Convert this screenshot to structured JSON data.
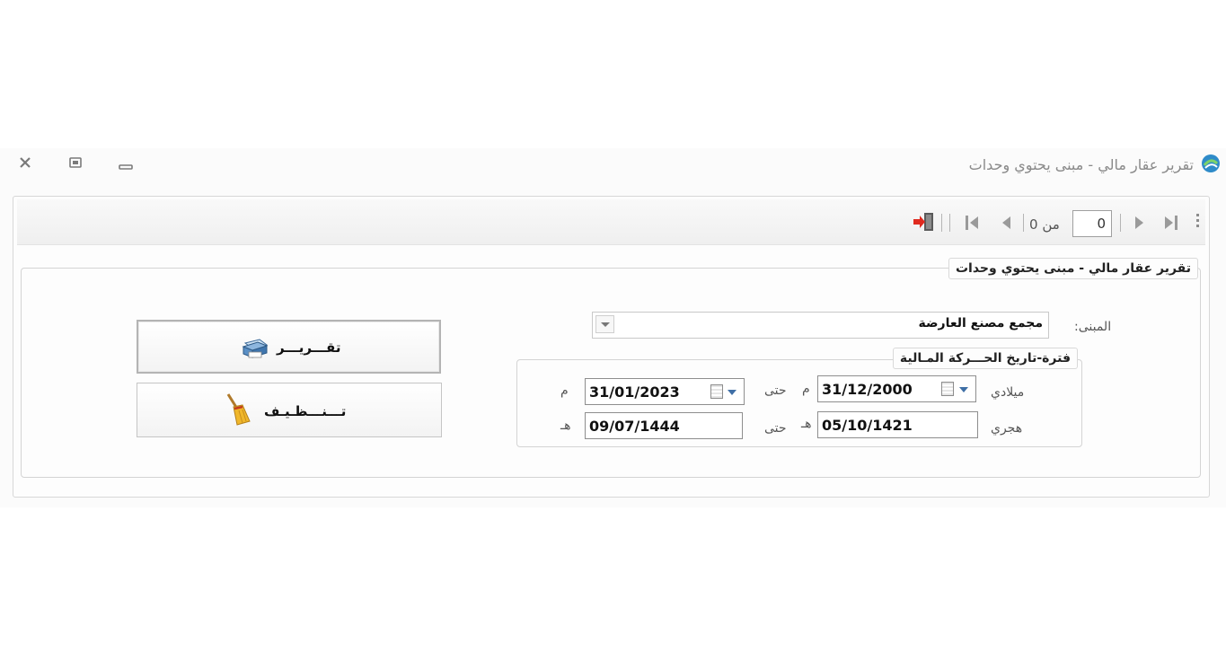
{
  "window": {
    "title": "تقرير عقار مالي - مبنى يحتوي وحدات",
    "controls": {
      "close": "close-icon",
      "restore": "restore-icon",
      "minimize": "minimize-icon"
    }
  },
  "toolbar": {
    "current_page": "0",
    "of_label": "من 0",
    "icons": [
      "last-page-icon",
      "next-page-icon",
      "previous-page-icon",
      "first-page-icon",
      "exit-icon"
    ]
  },
  "form": {
    "group_title": "تقرير عقار مالي - مبنى يحتوي وحدات",
    "building_label": "المبنى:",
    "building_value": "مجمع مصنع العارضة",
    "period_title": "فترة-تاريخ الحـــركة المـالية",
    "gregorian_label": "ميلادي",
    "hijri_label": "هجري",
    "to_label": "حتى",
    "to_label_2": "حتى",
    "g_suffix": "م",
    "g_suffix_2": "م",
    "h_suffix": "هـ",
    "h_suffix_2": "هـ",
    "gregorian_from": "31/12/2000",
    "gregorian_to": "31/01/2023",
    "hijri_from": "05/10/1421",
    "hijri_to": "09/07/1444"
  },
  "buttons": {
    "report_label": "تقـــريـــر",
    "clear_label": "تـــنـــظـيـف"
  },
  "colors": {
    "title_text": "#8a8a8a",
    "border": "#d4d4d4",
    "calendar_arrow": "#3f6fa6"
  }
}
